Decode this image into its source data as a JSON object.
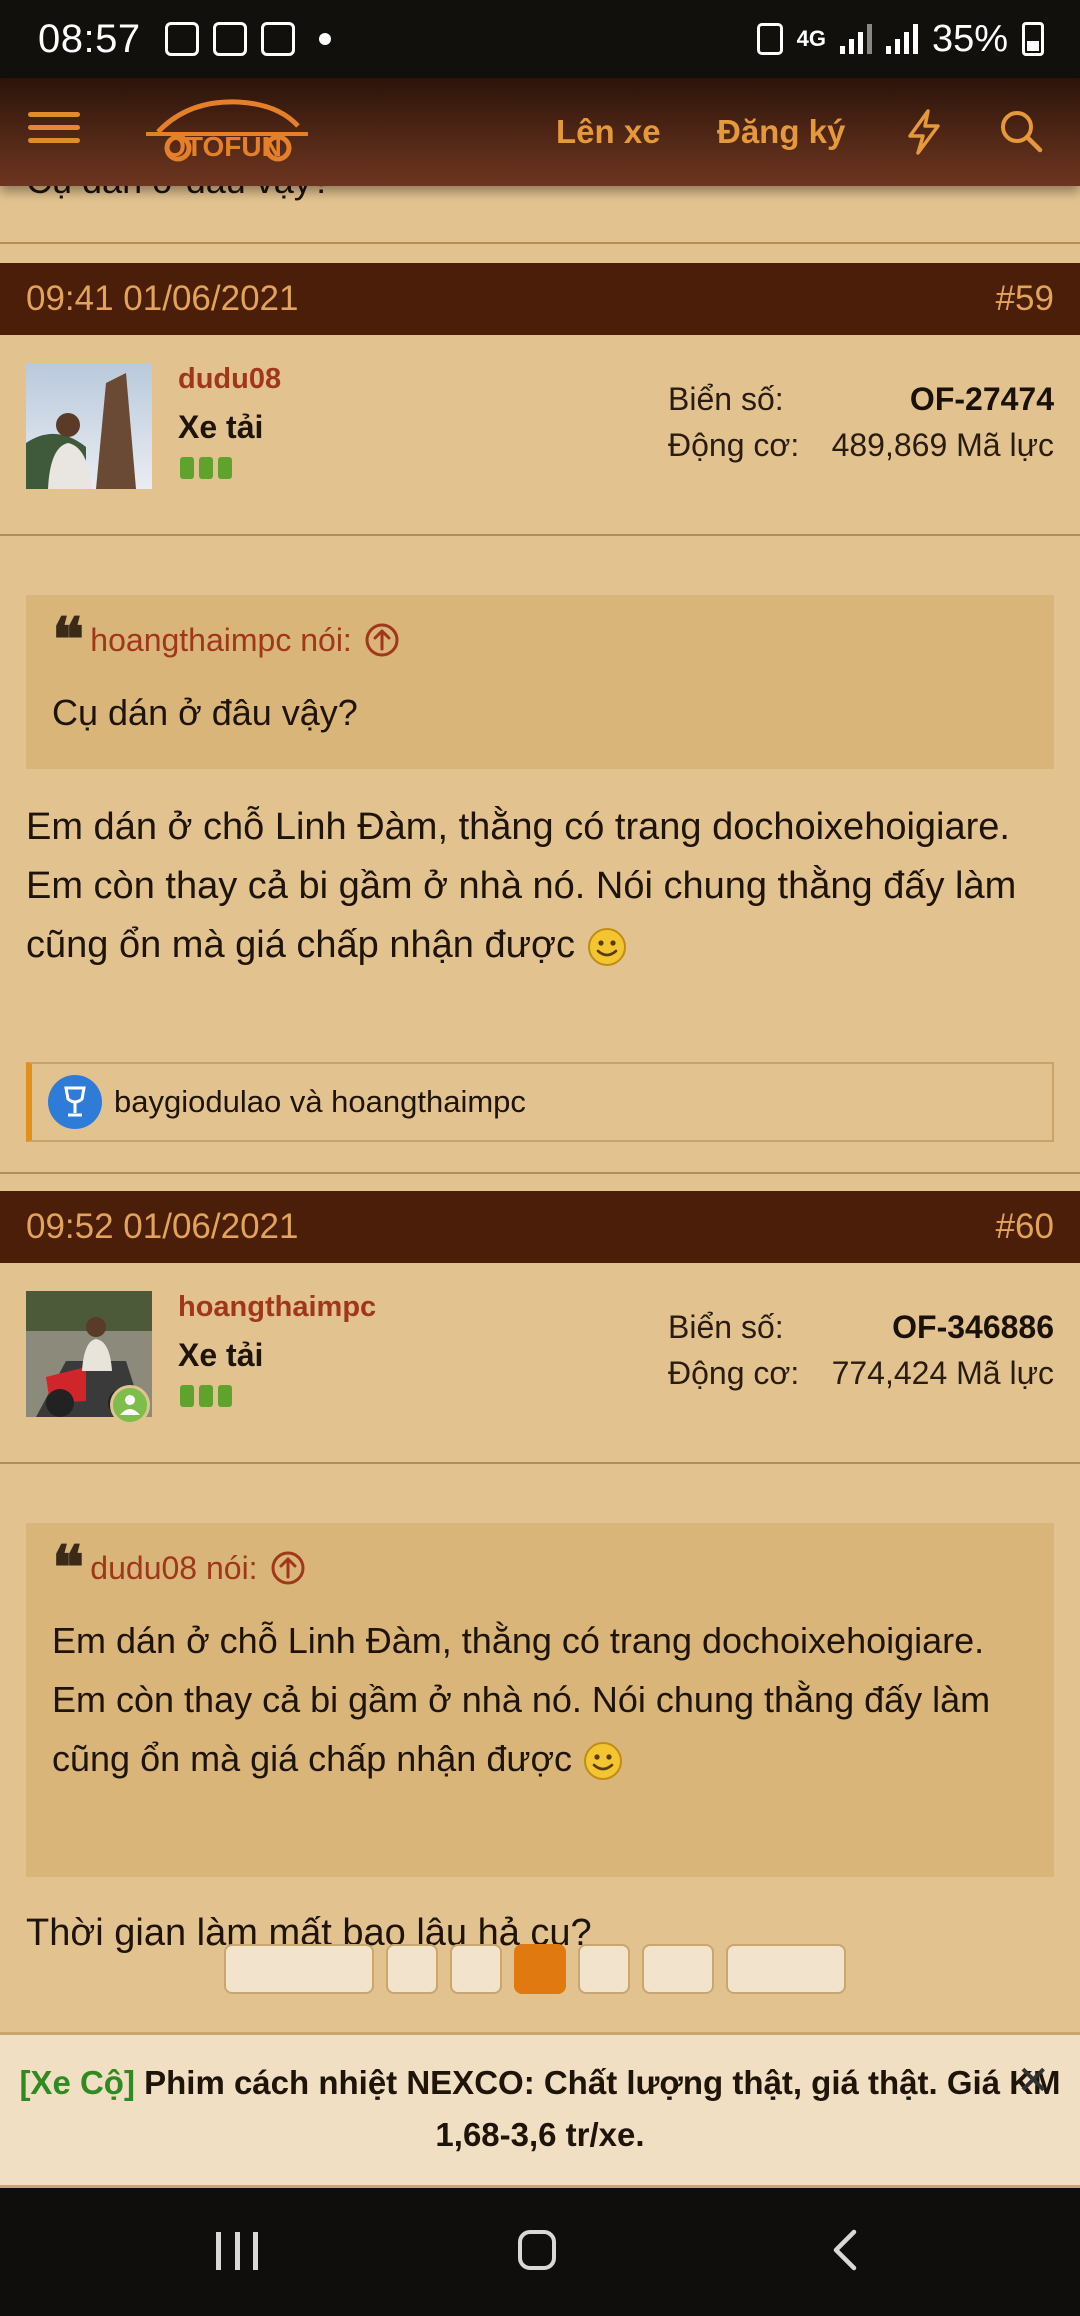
{
  "status_bar": {
    "time": "08:57",
    "network": "4G",
    "battery": "35%"
  },
  "header": {
    "logo_text": "OTOFUN",
    "login_label": "Lên xe",
    "register_label": "Đăng ký"
  },
  "previous_post_tail": "Cụ dán ở đâu vậy?",
  "posts": [
    {
      "datetime": "09:41 01/06/2021",
      "number": "#59",
      "username": "dudu08",
      "user_title": "Xe tải",
      "plate_label": "Biển số:",
      "plate_value": "OF-27474",
      "engine_label": "Động cơ:",
      "engine_value": "489,869 Mã lực",
      "quote_author": "hoangthaimpc nói:",
      "quote_text": "Cụ dán ở đâu vậy?",
      "message": "Em dán ở chỗ Linh Đàm, thằng có trang dochoixehoigiare. Em còn thay cả bi gầm ở nhà nó. Nói chung thằng đấy làm cũng ổn mà giá chấp nhận được",
      "reactions": "baygiodulao và hoangthaimpc"
    },
    {
      "datetime": "09:52 01/06/2021",
      "number": "#60",
      "username": "hoangthaimpc",
      "user_title": "Xe tải",
      "plate_label": "Biển số:",
      "plate_value": "OF-346886",
      "engine_label": "Động cơ:",
      "engine_value": "774,424 Mã lực",
      "quote_author": "dudu08 nói:",
      "quote_text": "Em dán ở chỗ Linh Đàm, thằng có trang dochoixehoigiare. Em còn thay cả bi gầm ở nhà nó. Nói chung thằng đấy làm cũng ổn mà giá chấp nhận được",
      "message": "Thời gian làm mất bao lâu hả cụ?"
    }
  ],
  "ad": {
    "tag": "[Xe Cộ]",
    "text": "Phim cách nhiệt NEXCO: Chất lượng thật, giá thật. Giá KM 1,68-3,6 tr/xe.",
    "close": "✕"
  },
  "colors": {
    "background": "#e2c390",
    "post_header": "#4a1e08",
    "accent": "#e5993a",
    "username": "#a0371b",
    "quote_bg": "#d9b57a",
    "ad_tag": "#2f8a22"
  }
}
